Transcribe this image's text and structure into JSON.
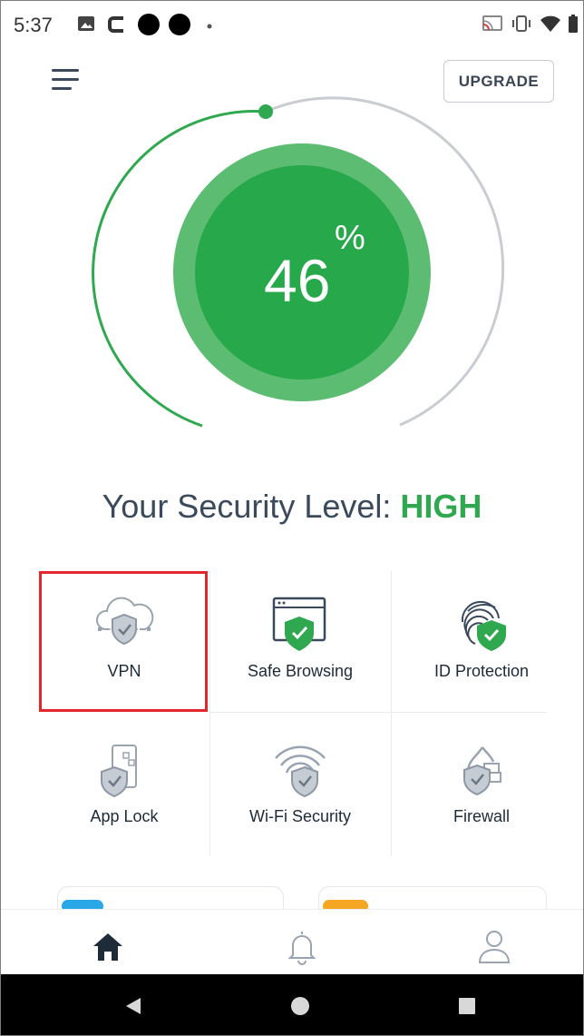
{
  "status_bar": {
    "time": "5:37"
  },
  "header": {
    "upgrade_label": "UPGRADE"
  },
  "score": {
    "value": "46",
    "unit": "%",
    "progress": 0.46
  },
  "security": {
    "prefix": "Your Security Level: ",
    "level": "HIGH"
  },
  "features": [
    {
      "label": "VPN",
      "icon": "vpn-cloud-shield-icon"
    },
    {
      "label": "Safe Browsing",
      "icon": "browser-shield-icon"
    },
    {
      "label": "ID Protection",
      "icon": "fingerprint-shield-icon"
    },
    {
      "label": "App Lock",
      "icon": "phone-lock-shield-icon"
    },
    {
      "label": "Wi-Fi Security",
      "icon": "wifi-shield-icon"
    },
    {
      "label": "Firewall",
      "icon": "firewall-shield-icon"
    }
  ],
  "colors": {
    "accent": "#2fa84f",
    "gauge_inner": "#27a84a",
    "gauge_ring": "#5cbd72",
    "highlight": "#e3262b"
  },
  "bottom_nav": [
    "home-icon",
    "bell-icon",
    "profile-icon"
  ]
}
